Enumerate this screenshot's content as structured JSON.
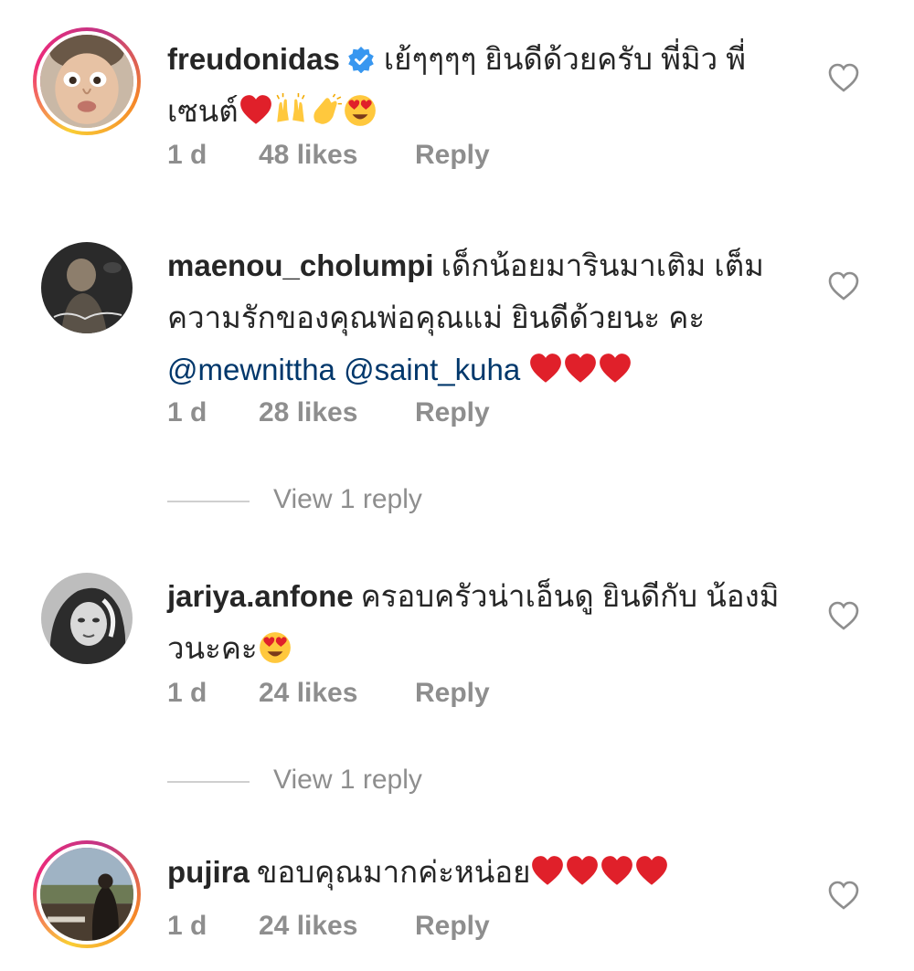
{
  "comments": [
    {
      "username": "freudonidas",
      "verified": true,
      "text": "เย้ๆๆๆๆ ยินดีด้วยครับ พี่มิว พี่เซนต์",
      "mentions": [],
      "emojis": [
        "red-heart",
        "raising-hands",
        "clapping-hands",
        "heart-eyes"
      ],
      "time": "1 d",
      "likes": "48 likes",
      "reply_label": "Reply"
    },
    {
      "username": "maenou_cholumpi",
      "verified": false,
      "text": "เด็กน้อยมารินมาเติม เต็มความรักของคุณพ่อคุณแม่ ยินดีด้วยนะ คะ",
      "mentions": [
        "@mewnittha",
        "@saint_kuha"
      ],
      "emojis": [
        "red-heart",
        "red-heart",
        "red-heart"
      ],
      "time": "1 d",
      "likes": "28 likes",
      "reply_label": "Reply",
      "view_replies": "View 1 reply"
    },
    {
      "username": "jariya.anfone",
      "verified": false,
      "text": "ครอบครัวน่าเอ็นดู  ยินดีกับ น้องมิวนะคะ",
      "mentions": [],
      "emojis": [
        "heart-eyes"
      ],
      "time": "1 d",
      "likes": "24 likes",
      "reply_label": "Reply",
      "view_replies": "View 1 reply"
    },
    {
      "username": "pujira",
      "verified": false,
      "text": "ขอบคุณมากค่ะหน่อย",
      "mentions": [],
      "emojis": [
        "red-heart",
        "red-heart",
        "red-heart",
        "red-heart"
      ],
      "time": "1 d",
      "likes": "24 likes",
      "reply_label": "Reply"
    }
  ],
  "colors": {
    "text": "#262626",
    "meta": "#8e8e8e",
    "mention": "#00376b",
    "verified": "#3897f0",
    "heart_emoji": "#e0202a"
  }
}
